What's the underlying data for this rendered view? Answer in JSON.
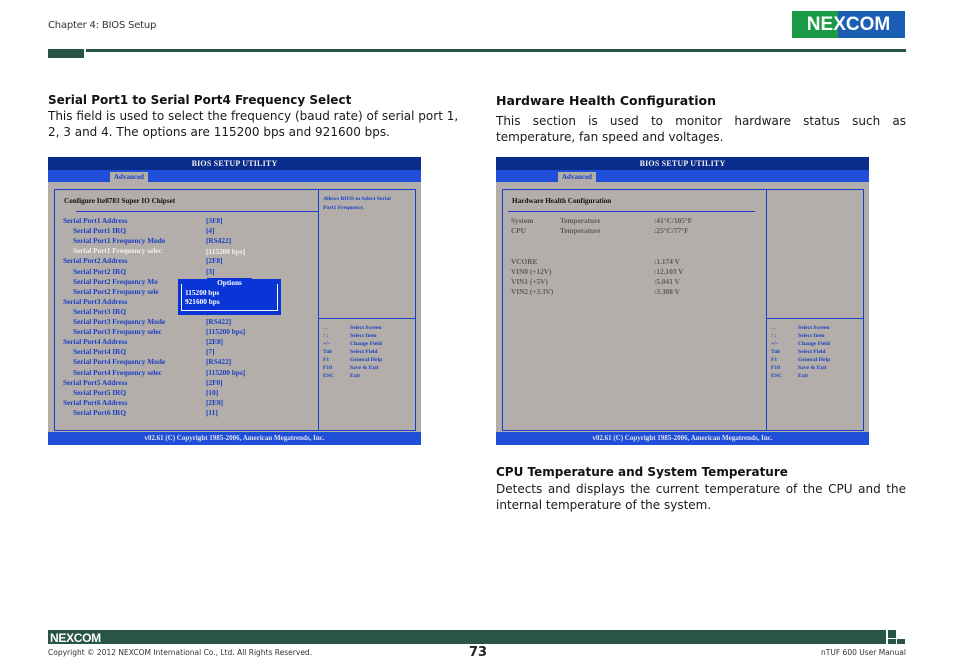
{
  "header": {
    "chapter": "Chapter 4: BIOS Setup",
    "logo": "NEXCOM"
  },
  "left_section": {
    "heading": "Serial Port1 to Serial Port4 Frequency Select",
    "body": "This field is used to select the frequency (baud rate) of serial port 1, 2, 3 and 4. The options are 115200 bps and 921600 bps."
  },
  "right_section": {
    "heading": "Hardware Health Configuration",
    "body": "This section is used to monitor hardware status such as temperature, fan speed and voltages."
  },
  "cpu_section": {
    "heading": "CPU Temperature and System Temperature",
    "body": "Detects and displays the current temperature of the CPU and the internal temperature of the system."
  },
  "bios_left": {
    "title": "BIOS SETUP UTILITY",
    "tab": "Advanced",
    "panel_title": "Configure Ite8783 Super IO Chipset",
    "help_text": [
      "Allows BIOS to Select Serial",
      "Port1 Frequency."
    ],
    "rows": [
      {
        "label": "Serial Port1 Address",
        "value": "[3F8]",
        "indent": false,
        "state": "normal"
      },
      {
        "label": "Serial Port1 IRQ",
        "value": "[4]",
        "indent": true,
        "state": "normal"
      },
      {
        "label": "Serial Port1 Frequency Mode",
        "value": "[RS422]",
        "indent": true,
        "state": "normal"
      },
      {
        "label": "Serial Port1 Frequency selec",
        "value": "[115200 bps]",
        "indent": true,
        "state": "highlighted"
      },
      {
        "label": "Serial Port2 Address",
        "value": "[2F8]",
        "indent": false,
        "state": "normal"
      },
      {
        "label": "Serial Port2 IRQ",
        "value": "[3]",
        "indent": true,
        "state": "normal"
      },
      {
        "label": "Serial Port2 Frequency Mo",
        "value": "",
        "indent": true,
        "state": "normal"
      },
      {
        "label": "Serial Port2 Frequency sele",
        "value": "",
        "indent": true,
        "state": "normal"
      },
      {
        "label": "Serial Port3 Address",
        "value": "",
        "indent": false,
        "state": "normal"
      },
      {
        "label": "Serial Port3 IRQ",
        "value": "[",
        "indent": true,
        "state": "normal"
      },
      {
        "label": "Serial Port3 Frequency Mode",
        "value": "[RS422]",
        "indent": true,
        "state": "normal"
      },
      {
        "label": "Serial Port3 Frequency selec",
        "value": "[115200 bps]",
        "indent": true,
        "state": "normal"
      },
      {
        "label": "Serial Port4 Address",
        "value": "[2E8]",
        "indent": false,
        "state": "normal"
      },
      {
        "label": "Serial Port4 IRQ",
        "value": "[7]",
        "indent": true,
        "state": "normal"
      },
      {
        "label": "Serial Port4 Frequency Mode",
        "value": "[RS422]",
        "indent": true,
        "state": "normal"
      },
      {
        "label": "Serial Port4 Frequency selec",
        "value": "[115200 bps]",
        "indent": true,
        "state": "normal"
      },
      {
        "label": "Serial Port5 Address",
        "value": "[2F0]",
        "indent": false,
        "state": "normal"
      },
      {
        "label": "Serial Port5 IRQ",
        "value": "[10]",
        "indent": true,
        "state": "normal"
      },
      {
        "label": "Serial Port6 Address",
        "value": "[2E0]",
        "indent": false,
        "state": "normal"
      },
      {
        "label": "Serial Port6 IRQ",
        "value": "[11]",
        "indent": true,
        "state": "normal"
      }
    ],
    "popup": {
      "title": "Options",
      "options": [
        "115200 bps",
        "921600 bps"
      ]
    },
    "keys": [
      {
        "key": "←",
        "action": "Select Screen"
      },
      {
        "key": "↑↓",
        "action": "Select Item"
      },
      {
        "key": "+/-",
        "action": "Change Field"
      },
      {
        "key": "Tab",
        "action": "Select Field"
      },
      {
        "key": "F1",
        "action": "General Help"
      },
      {
        "key": "F10",
        "action": "Save & Exit"
      },
      {
        "key": "ESC",
        "action": "Exit"
      }
    ],
    "footer": "v02.61 (C) Copyright 1985-2006, American Megatrends, Inc."
  },
  "bios_right": {
    "title": "BIOS SETUP UTILITY",
    "tab": "Advanced",
    "panel_title": "Hardware Health Configuration",
    "readings": [
      {
        "label": "System",
        "sub": "Temperature",
        "value": ":41°C/105°F"
      },
      {
        "label": "CPU",
        "sub": "Temperature",
        "value": ":25°C/77°F"
      },
      {
        "label": "VCORE",
        "sub": "",
        "value": ":1.174 V"
      },
      {
        "label": "VIN0 (+12V)",
        "sub": "",
        "value": ":12.103 V"
      },
      {
        "label": "VIN1 (+5V)",
        "sub": "",
        "value": ":5.041 V"
      },
      {
        "label": "VIN2 (+3.3V)",
        "sub": "",
        "value": ":3.308 V"
      }
    ],
    "keys": [
      {
        "key": "←",
        "action": "Select Screen"
      },
      {
        "key": "↑↓",
        "action": "Select Item"
      },
      {
        "key": "+/-",
        "action": "Change Field"
      },
      {
        "key": "Tab",
        "action": "Select Field"
      },
      {
        "key": "F1",
        "action": "General Help"
      },
      {
        "key": "F10",
        "action": "Save & Exit"
      },
      {
        "key": "ESC",
        "action": "Exit"
      }
    ],
    "footer": "v02.61 (C) Copyright 1985-2006, American Megatrends, Inc."
  },
  "footer": {
    "logo": "NEXCOM",
    "copyright": "Copyright © 2012 NEXCOM International Co., Ltd. All Rights Reserved.",
    "page_number": "73",
    "manual": "nTUF 600 User Manual"
  }
}
